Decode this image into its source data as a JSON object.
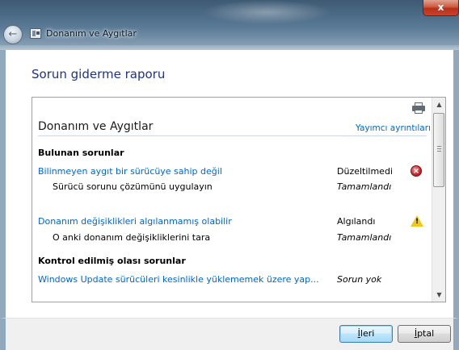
{
  "window": {
    "title": "Donanım ve Aygıtlar",
    "close_label": "x",
    "back_label": "←"
  },
  "page": {
    "heading": "Sorun giderme raporu"
  },
  "report": {
    "title": "Donanım ve Aygıtlar",
    "publisher_link": "Yayımcı ayrıntıları",
    "found_header": "Bulunan sorunlar",
    "checked_header": "Kontrol edilmiş olası sorunlar",
    "items": [
      {
        "problem": "Bilinmeyen aygıt bir sürücüye sahip değil",
        "status": "Düzeltilmedi",
        "status_icon": "error-icon",
        "action": "Sürücü sorunu çözümünü uygulayın",
        "action_status": "Tamamlandı"
      },
      {
        "problem": "Donanım değişiklikleri algılanmamış olabilir",
        "status": "Algılandı",
        "status_icon": "warning-icon",
        "action": "O anki donanım değişikliklerini tara",
        "action_status": "Tamamlandı"
      }
    ],
    "checked": [
      {
        "problem": "Windows Update sürücüleri kesinlikle yüklememek üzere yap...",
        "status": "Sorun yok"
      }
    ],
    "partial_next_row": "......"
  },
  "footer": {
    "next_button_u": "İ",
    "next_button_rest": "leri",
    "cancel_button_u": "İ",
    "cancel_button_rest": "ptal"
  },
  "colors": {
    "link": "#0066cc",
    "heading": "#1e3287",
    "error": "#c9232a",
    "warning": "#f2c81a"
  }
}
